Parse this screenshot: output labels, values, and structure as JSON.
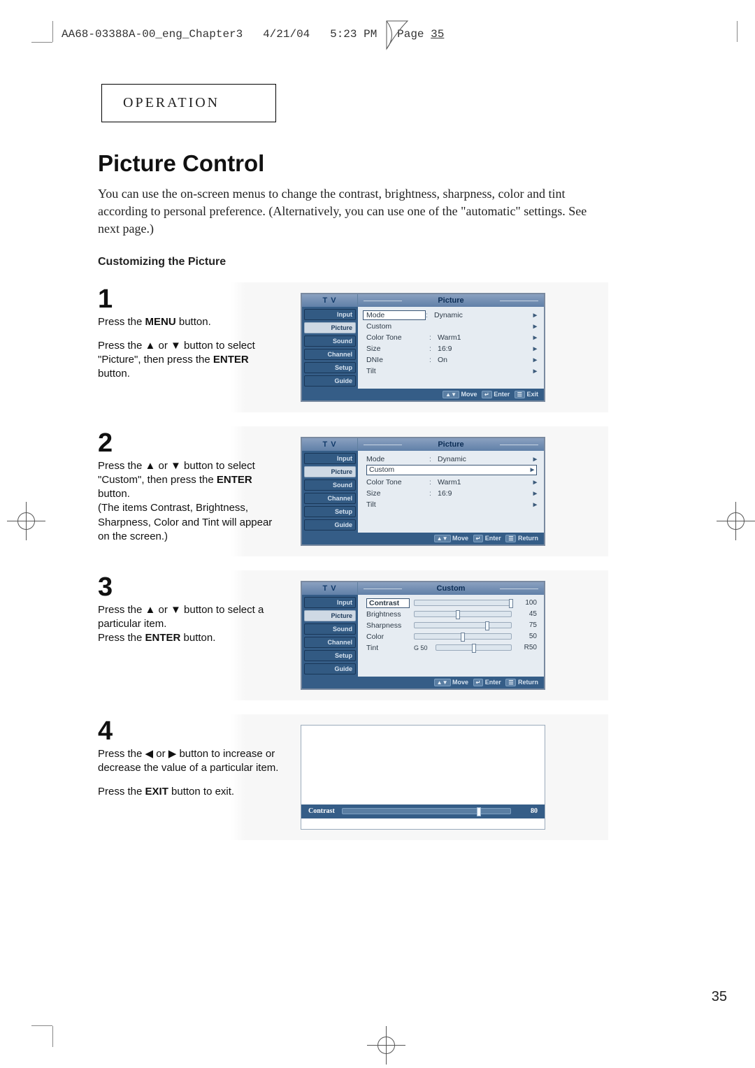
{
  "slug": {
    "file": "AA68-03388A-00_eng_Chapter3",
    "date": "4/21/04",
    "time": "5:23 PM",
    "page_word": "Page",
    "page_no": "35"
  },
  "section_label": "OPERATION",
  "title": "Picture Control",
  "intro": "You can use the on-screen menus to change the contrast, brightness, sharpness, color and tint according to personal preference. (Alternatively, you can use one of the \"automatic\" settings. See next page.)",
  "subheading": "Customizing the Picture",
  "steps": {
    "one": {
      "num": "1",
      "lines": [
        "Press the **MENU** button.",
        "Press the ▲ or ▼ button to select \"Picture\", then press the **ENTER** button."
      ]
    },
    "two": {
      "num": "2",
      "lines": [
        "Press the ▲ or ▼ button to select \"Custom\", then press the **ENTER** button.",
        "(The items Contrast, Brightness, Sharpness, Color and Tint will appear on the screen.)"
      ]
    },
    "three": {
      "num": "3",
      "lines": [
        "Press the ▲ or ▼ button to select a particular item.",
        "Press the **ENTER** button."
      ]
    },
    "four": {
      "num": "4",
      "lines": [
        "Press the ◀ or ▶ button to increase or decrease the value of a particular item.",
        "Press the **EXIT** button to exit."
      ]
    }
  },
  "osd": {
    "tv_label": "T V",
    "nav": [
      "Input",
      "Picture",
      "Sound",
      "Channel",
      "Setup",
      "Guide"
    ],
    "picture_title": "Picture",
    "custom_title": "Custom",
    "rows1": [
      {
        "k": "Mode",
        "sep": ":",
        "v": "Dynamic"
      },
      {
        "k": "Custom",
        "sep": "",
        "v": ""
      },
      {
        "k": "Color Tone",
        "sep": ":",
        "v": "Warm1"
      },
      {
        "k": "Size",
        "sep": ":",
        "v": "16:9"
      },
      {
        "k": "DNIe",
        "sep": ":",
        "v": "On"
      },
      {
        "k": "Tilt",
        "sep": "",
        "v": ""
      }
    ],
    "sliders": [
      {
        "k": "Contrast",
        "val": "100",
        "pct": 100
      },
      {
        "k": "Brightness",
        "val": "45",
        "pct": 45
      },
      {
        "k": "Sharpness",
        "val": "75",
        "pct": 75
      },
      {
        "k": "Color",
        "val": "50",
        "pct": 50
      },
      {
        "k": "Tint",
        "prefix": "G 50",
        "val": "R50",
        "pct": 50
      }
    ],
    "foot_move": "Move",
    "foot_enter": "Enter",
    "foot_exit": "Exit",
    "foot_return": "Return",
    "bar": {
      "label": "Contrast",
      "val": "80",
      "pct": 80
    }
  },
  "page_number": "35",
  "icons": {
    "up": "▲",
    "down": "▼",
    "left": "◀",
    "right": "▶",
    "updown": "▲▼",
    "enter_key": "↵",
    "menu_key": "☰"
  }
}
